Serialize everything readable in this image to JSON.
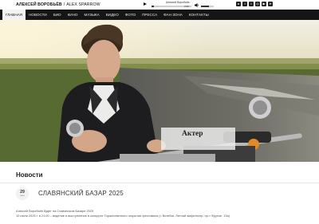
{
  "brand": {
    "name": "АЛЕКСЕЙ ВОРОБЬЁВ",
    "separator": "/",
    "alias": "ALEX SPARROW"
  },
  "player": {
    "track": "Алексей Воробьёв",
    "time": "0:00",
    "progress": 0.05,
    "volume": 0.6,
    "play_icon": "play-icon",
    "volume_icon": "speaker-icon"
  },
  "social": [
    {
      "icon": "vk-icon",
      "glyph": "в"
    },
    {
      "icon": "facebook-icon",
      "glyph": "f"
    },
    {
      "icon": "twitter-icon",
      "glyph": "t"
    },
    {
      "icon": "instagram-icon",
      "glyph": "◎"
    },
    {
      "icon": "youtube-icon",
      "glyph": "▶"
    },
    {
      "icon": "telegram-icon",
      "glyph": "➤"
    }
  ],
  "nav": [
    {
      "label": "ГЛАВНАЯ",
      "active": true
    },
    {
      "label": "НОВОСТИ"
    },
    {
      "label": "БИО"
    },
    {
      "label": "КИНО"
    },
    {
      "label": "МУЗЫКА"
    },
    {
      "label": "ВИДЕО"
    },
    {
      "label": "ФОТО"
    },
    {
      "label": "ПРЕССА"
    },
    {
      "label": "ФАН ЗОНА"
    },
    {
      "label": "КОНТАКТЫ"
    }
  ],
  "hero": {
    "caption": "Актер"
  },
  "news": {
    "title": "Новости",
    "post": {
      "day": "29",
      "month": "июн",
      "title": "СЛАВЯНСКИЙ БАЗАР 2025",
      "line1": "Алексей Воробьёв будет на Славянском Базаре 2025",
      "line2": "10 июля 2025 г. в 21:00 – ведение и выступление в концерте Торжественного открытия фестиваля (г. Витебск, Летний амфитеатр, пр-т Фрунзе, 13а)"
    }
  },
  "colors": {
    "nav_bg": "#151515",
    "accent": "#111111"
  }
}
